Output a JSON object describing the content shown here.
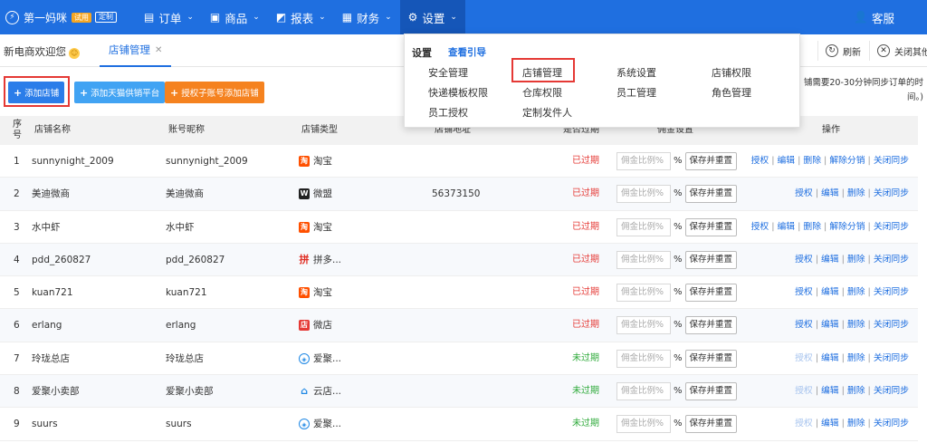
{
  "nav": {
    "brand": "第一妈咪",
    "badge_trial": "试用",
    "badge_custom": "定制",
    "items": [
      {
        "label": "订单",
        "icon": "order-icon"
      },
      {
        "label": "商品",
        "icon": "product-icon"
      },
      {
        "label": "报表",
        "icon": "chart-icon"
      },
      {
        "label": "财务",
        "icon": "finance-icon"
      },
      {
        "label": "设置",
        "icon": "gear-icon"
      }
    ],
    "service": "客服"
  },
  "tabs": {
    "welcome": "新电商欢迎您",
    "active": "店铺管理",
    "refresh": "刷新",
    "close_others": "关闭其他"
  },
  "actions": {
    "add_shop": "添加店铺",
    "add_supply": "添加天猫供销平台",
    "auth_sub": "授权子账号添加店铺",
    "notice_line1": "铺需要20-30分钟同步订单的时",
    "notice_line2": "间。)"
  },
  "table": {
    "headers": {
      "no": "序号",
      "name": "店铺名称",
      "account": "账号昵称",
      "type": "店铺类型",
      "address": "店铺地址",
      "expired": "是否过期",
      "commission": "佣金设置",
      "ops": "操作"
    },
    "commission_placeholder": "佣金比例%",
    "pct": "%",
    "save_label": "保存并重置",
    "sep": "|",
    "rows": [
      {
        "no": "1",
        "name": "sunnynight_2009",
        "account": "sunnynight_2009",
        "platform": "淘宝",
        "plat_icon": "淘",
        "plat_class": "p-tb",
        "address": "",
        "expired": "已过期",
        "exp_class": "exp-red",
        "ops": [
          "授权",
          "编辑",
          "删除",
          "解除分销",
          "关闭同步"
        ],
        "auth_disabled": false
      },
      {
        "no": "2",
        "name": "美迪微商",
        "account": "美迪微商",
        "platform": "微盟",
        "plat_icon": "W",
        "plat_class": "p-wm",
        "address": "56373150",
        "expired": "已过期",
        "exp_class": "exp-red",
        "ops": [
          "授权",
          "编辑",
          "删除",
          "关闭同步"
        ],
        "auth_disabled": false
      },
      {
        "no": "3",
        "name": "水中虾",
        "account": "水中虾",
        "platform": "淘宝",
        "plat_icon": "淘",
        "plat_class": "p-tb",
        "address": "",
        "expired": "已过期",
        "exp_class": "exp-red",
        "ops": [
          "授权",
          "编辑",
          "删除",
          "解除分销",
          "关闭同步"
        ],
        "auth_disabled": false
      },
      {
        "no": "4",
        "name": "pdd_260827",
        "account": "pdd_260827",
        "platform": "拼多...",
        "plat_icon": "拼",
        "plat_class": "p-pdd",
        "address": "",
        "expired": "已过期",
        "exp_class": "exp-red",
        "ops": [
          "授权",
          "编辑",
          "删除",
          "关闭同步"
        ],
        "auth_disabled": false
      },
      {
        "no": "5",
        "name": "kuan721",
        "account": "kuan721",
        "platform": "淘宝",
        "plat_icon": "淘",
        "plat_class": "p-tb",
        "address": "",
        "expired": "已过期",
        "exp_class": "exp-red",
        "ops": [
          "授权",
          "编辑",
          "删除",
          "关闭同步"
        ],
        "auth_disabled": false
      },
      {
        "no": "6",
        "name": "erlang",
        "account": "erlang",
        "platform": "微店",
        "plat_icon": "店",
        "plat_class": "p-wd",
        "address": "",
        "expired": "已过期",
        "exp_class": "exp-red",
        "ops": [
          "授权",
          "编辑",
          "删除",
          "关闭同步"
        ],
        "auth_disabled": false
      },
      {
        "no": "7",
        "name": "玲珑总店",
        "account": "玲珑总店",
        "platform": "爱聚...",
        "plat_icon": "◈",
        "plat_class": "p-ajj",
        "address": "",
        "expired": "未过期",
        "exp_class": "exp-green",
        "ops": [
          "授权",
          "编辑",
          "删除",
          "关闭同步"
        ],
        "auth_disabled": true
      },
      {
        "no": "8",
        "name": "爱聚小卖部",
        "account": "爱聚小卖部",
        "platform": "云店...",
        "plat_icon": "⌂",
        "plat_class": "p-yd",
        "address": "",
        "expired": "未过期",
        "exp_class": "exp-green",
        "ops": [
          "授权",
          "编辑",
          "删除",
          "关闭同步"
        ],
        "auth_disabled": true
      },
      {
        "no": "9",
        "name": "suurs",
        "account": "suurs",
        "platform": "爱聚...",
        "plat_icon": "◈",
        "plat_class": "p-ajj",
        "address": "",
        "expired": "未过期",
        "exp_class": "exp-green",
        "ops": [
          "授权",
          "编辑",
          "删除",
          "关闭同步"
        ],
        "auth_disabled": true
      }
    ]
  },
  "dropdown": {
    "title": "设置",
    "guide": "查看引导",
    "items": [
      {
        "label": "安全管理"
      },
      {
        "label": "店铺管理"
      },
      {
        "label": "系统设置"
      },
      {
        "label": "店铺权限"
      },
      {
        "label": "快递模板权限"
      },
      {
        "label": "仓库权限"
      },
      {
        "label": "员工管理"
      },
      {
        "label": "角色管理"
      },
      {
        "label": "员工授权"
      },
      {
        "label": "定制发件人"
      }
    ]
  }
}
